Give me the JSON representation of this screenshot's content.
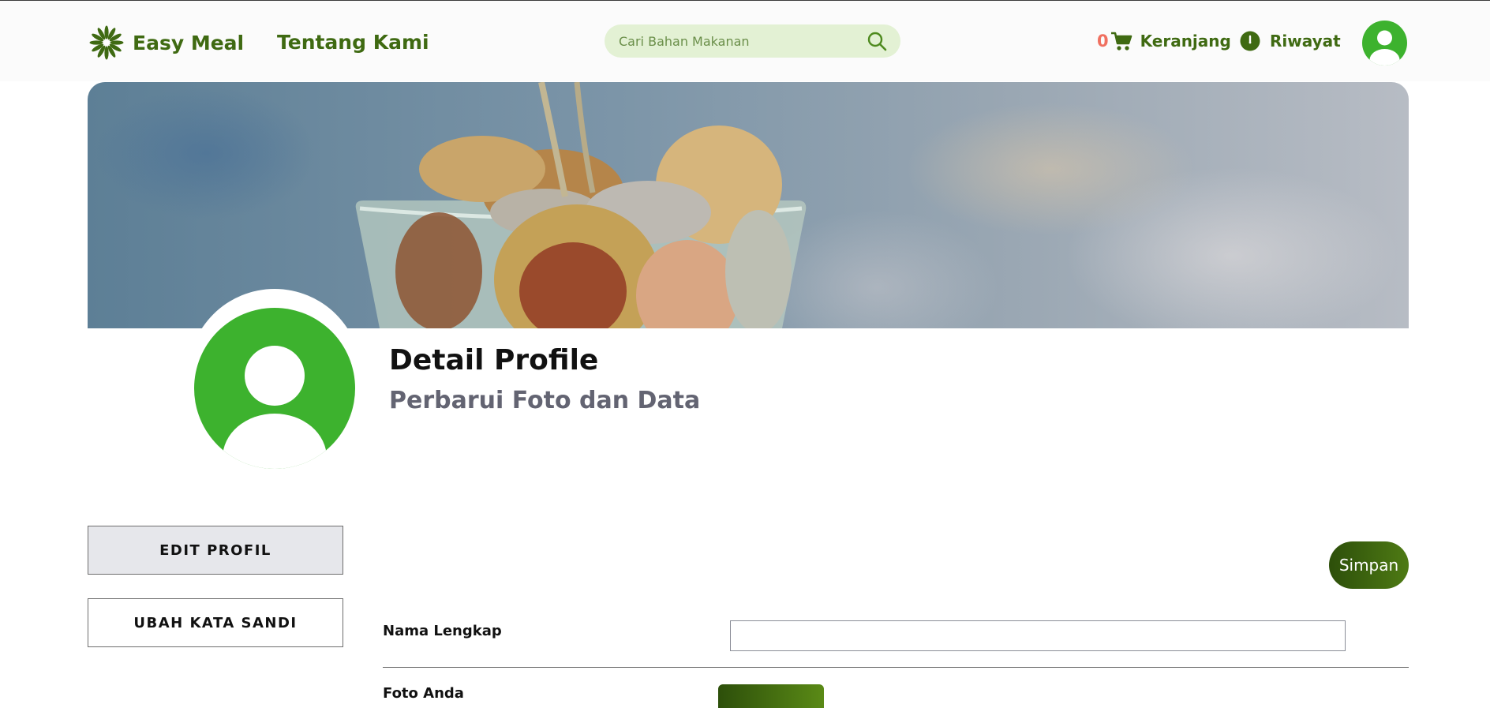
{
  "navbar": {
    "brand": "Easy Meal",
    "about_link": "Tentang Kami",
    "search": {
      "placeholder": "Cari Bahan Makanan",
      "value": ""
    },
    "cart": {
      "count": "0",
      "label": "Keranjang"
    },
    "history": {
      "label": "Riwayat"
    }
  },
  "profile": {
    "title": "Detail Profile",
    "subtitle": "Perbarui Foto dan Data"
  },
  "sidebar": {
    "edit_profile": "EDIT PROFIL",
    "change_password": "UBAH KATA SANDI"
  },
  "form": {
    "save_label": "Simpan",
    "full_name_label": "Nama Lengkap",
    "full_name_value": "",
    "photo_label": "Foto Anda"
  },
  "colors": {
    "brand_green": "#3f6a12",
    "avatar_green": "#3db22e",
    "search_bg": "#e3f1d4",
    "cart_count": "#f07060",
    "button_dark_green": "#2d4f0a"
  },
  "icons": [
    "easy-meal-logo-icon",
    "search-icon",
    "cart-icon",
    "history-icon",
    "user-avatar-icon"
  ]
}
